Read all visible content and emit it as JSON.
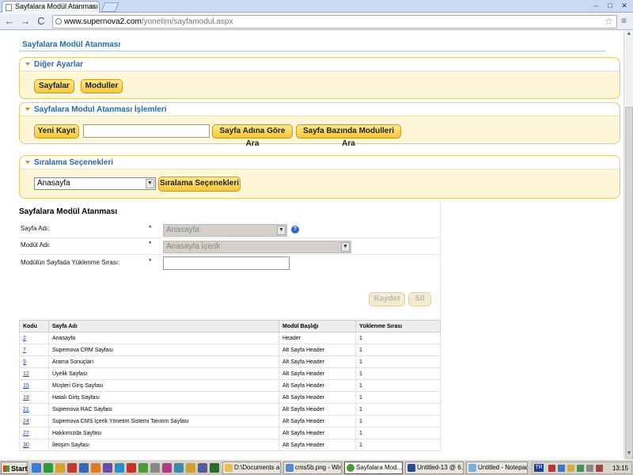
{
  "browser": {
    "tab_title": "Sayfalara Modül Atanması",
    "tab_close": "×",
    "url_host": "www.supernova2.com",
    "url_path": "/yonetim/sayfamodul.aspx",
    "back": "←",
    "forward": "→",
    "reload": "C",
    "star": "☆",
    "wrench": "🔧",
    "win_min": "–",
    "win_max": "□",
    "win_close": "✕"
  },
  "page": {
    "heading": "Sayfalara Modül Atanması"
  },
  "panels": {
    "diger": {
      "title": "Diğer Ayarlar",
      "btn_sayfalar": "Sayfalar",
      "btn_moduller": "Moduller"
    },
    "islemler": {
      "title": "Sayfalara Modul Atanması İşlemleri",
      "btn_yeni": "Yeni Kayıt",
      "search_value": "",
      "btn_sayfa_ara": "Sayfa Adına Göre Ara",
      "btn_modul_ara": "Sayfa Bazında Modulleri Ara"
    },
    "siralama": {
      "title": "Sıralama Seçenekleri",
      "select_value": "Anasayfa",
      "btn_siralama": "Sıralama Seçenekleri"
    }
  },
  "form": {
    "title": "Sayfalara Modül Atanması",
    "sayfa_adi_label": "Sayfa Adı:",
    "sayfa_adi_value": "Anasayfa",
    "modul_adi_label": "Modül Adı:",
    "modul_adi_value": "Anasayfa İçerik",
    "sira_label": "Modülün Sayfada Yüklenme Sırası:",
    "sira_value": "",
    "required_mark": "*",
    "help": "?",
    "btn_kaydet": "Kaydet",
    "btn_sil": "Sil"
  },
  "table": {
    "headers": [
      "Kodu",
      "Sayfa Adı",
      "Modül Başlığı",
      "Yüklenme Sırası"
    ],
    "rows": [
      {
        "code": "2",
        "page": "Anasayfa",
        "module": "Header",
        "order": "1"
      },
      {
        "code": "7",
        "page": "Supernova CRM Sayfası",
        "module": "Alt Sayfa Header",
        "order": "1"
      },
      {
        "code": "9",
        "page": "Arama Sonuçları",
        "module": "Alt Sayfa Header",
        "order": "1"
      },
      {
        "code": "12",
        "page": "Üyelik Sayfası",
        "module": "Alt Sayfa Header",
        "order": "1"
      },
      {
        "code": "15",
        "page": "Müşteri Giriş Sayfası",
        "module": "Alt Sayfa Header",
        "order": "1"
      },
      {
        "code": "18",
        "page": "Hatalı Giriş Sayfası",
        "module": "Alt Sayfa Header",
        "order": "1"
      },
      {
        "code": "21",
        "page": "Supernova RAC Sayfası",
        "module": "Alt Sayfa Header",
        "order": "1"
      },
      {
        "code": "24",
        "page": "Supernova CMS İçerik Yönetim Sistemi Tanıtım Sayfası",
        "module": "Alt Sayfa Header",
        "order": "1"
      },
      {
        "code": "27",
        "page": "Hakkımızda Sayfası",
        "module": "Alt Sayfa Header",
        "order": "1"
      },
      {
        "code": "30",
        "page": "İletişim Sayfası",
        "module": "Alt Sayfa Header",
        "order": "1"
      }
    ]
  },
  "taskbar": {
    "start": "Start",
    "items": [
      "D:\\Documents a...",
      "cms5b.png - Win...",
      "Sayfalara Mod...",
      "Untitled-13 @ 6...",
      "Untitled - Notepad"
    ],
    "lang": "TR",
    "clock": "13:15"
  }
}
